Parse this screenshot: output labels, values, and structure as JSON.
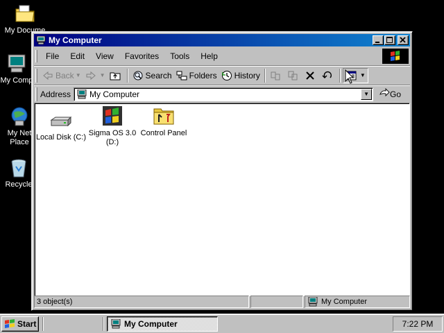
{
  "desktop": {
    "icons": [
      {
        "label": "My Docume",
        "icon": "folder-documents-icon"
      },
      {
        "label": "My Comp",
        "icon": "computer-icon"
      },
      {
        "label": "My Net",
        "label2": "Place",
        "icon": "network-icon"
      },
      {
        "label": "Recycle",
        "icon": "recycle-bin-icon"
      }
    ]
  },
  "window": {
    "title": "My Computer",
    "controls": {
      "minimize": "_",
      "maximize": "□",
      "close": "×"
    },
    "menu": [
      "File",
      "Edit",
      "View",
      "Favorites",
      "Tools",
      "Help"
    ],
    "toolbar": {
      "back": "Back",
      "search": "Search",
      "folders": "Folders",
      "history": "History"
    },
    "address": {
      "label": "Address",
      "value": "My Computer",
      "go": "Go"
    },
    "items": [
      {
        "label": "Local Disk (C:)",
        "icon": "hard-disk-icon"
      },
      {
        "label": "Sigma OS 3.0",
        "label2": "(D:)",
        "icon": "cdrom-windows-icon"
      },
      {
        "label": "Control Panel",
        "icon": "control-panel-folder-icon"
      }
    ],
    "status": {
      "count": "3 object(s)",
      "location": "My Computer"
    }
  },
  "taskbar": {
    "start": "Start",
    "task": "My Computer",
    "clock": "7:22 PM"
  },
  "colors": {
    "titlebar_start": "#000080",
    "titlebar_end": "#1084d0",
    "face": "#c0c0c0",
    "desktop": "#000000"
  }
}
